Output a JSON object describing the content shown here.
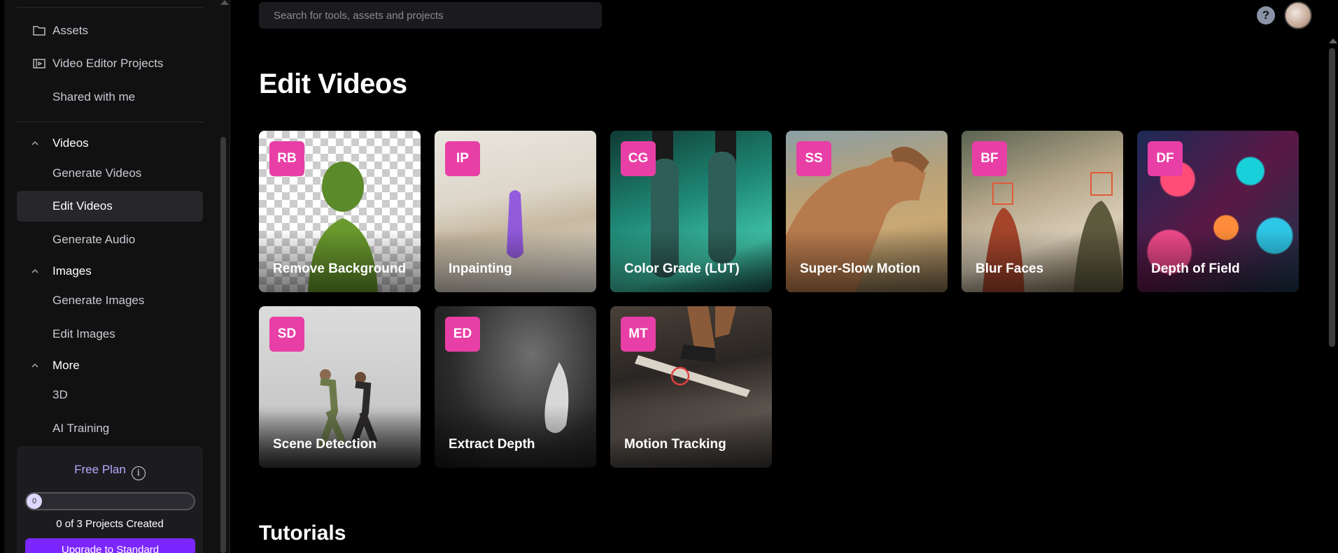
{
  "sidebar": {
    "top_items": [
      {
        "label": "Assets",
        "icon": "folder-icon"
      },
      {
        "label": "Video Editor Projects",
        "icon": "video-project-icon"
      },
      {
        "label": "Shared with me",
        "icon": ""
      }
    ],
    "sections": [
      {
        "label": "Videos",
        "items": [
          "Generate Videos",
          "Edit Videos",
          "Generate Audio"
        ]
      },
      {
        "label": "Images",
        "items": [
          "Generate Images",
          "Edit Images"
        ]
      },
      {
        "label": "More",
        "items": [
          "3D",
          "AI Training"
        ]
      }
    ],
    "active_item": "Edit Videos",
    "plan": {
      "title": "Free Plan",
      "info_icon": "i",
      "progress_value": "0",
      "progress_fraction": 0,
      "count_text": "0 of 3 Projects Created",
      "upgrade_label": "Upgrade to Standard"
    }
  },
  "header": {
    "search_placeholder": "Search for tools, assets and projects",
    "help_icon": "?"
  },
  "main": {
    "page_title": "Edit Videos",
    "tools": [
      {
        "badge": "RB",
        "title": "Remove Background"
      },
      {
        "badge": "IP",
        "title": "Inpainting"
      },
      {
        "badge": "CG",
        "title": "Color Grade (LUT)"
      },
      {
        "badge": "SS",
        "title": "Super-Slow Motion"
      },
      {
        "badge": "BF",
        "title": "Blur Faces"
      },
      {
        "badge": "DF",
        "title": "Depth of Field"
      },
      {
        "badge": "SD",
        "title": "Scene Detection"
      },
      {
        "badge": "ED",
        "title": "Extract Depth"
      },
      {
        "badge": "MT",
        "title": "Motion Tracking"
      }
    ],
    "tutorials_title": "Tutorials"
  },
  "colors": {
    "badge": "#e83fa6",
    "accent": "#7c26ff",
    "plan_title": "#b9a6ff"
  }
}
